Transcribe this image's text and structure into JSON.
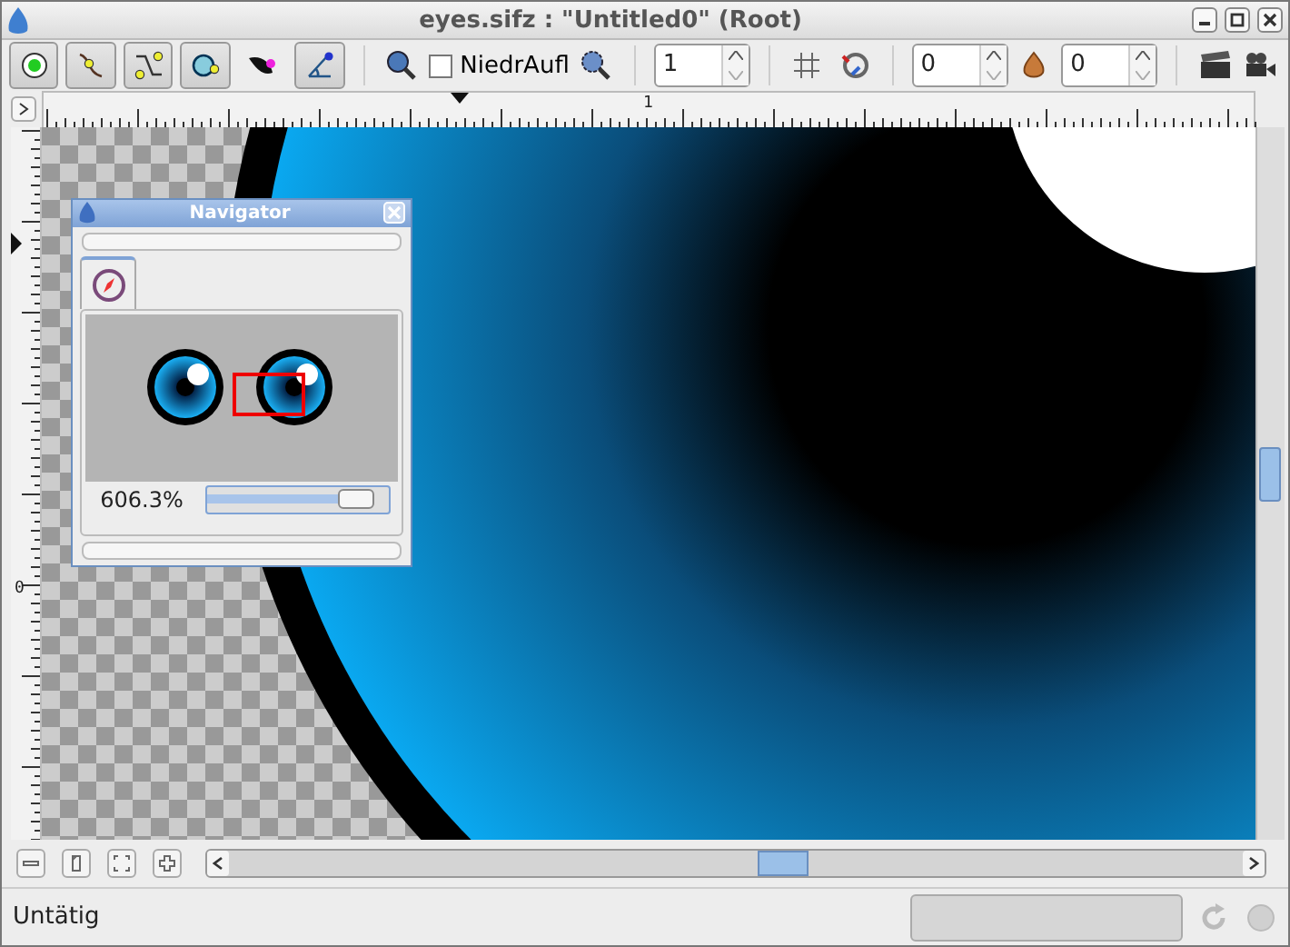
{
  "window": {
    "title": "eyes.sifz : \"Untitled0\" (Root)"
  },
  "toolbar": {
    "tools": [
      {
        "kind": "circle",
        "on": true
      },
      {
        "kind": "bline",
        "on": true
      },
      {
        "kind": "transform",
        "on": true
      },
      {
        "kind": "ring",
        "on": true
      },
      {
        "kind": "feather",
        "on": false
      },
      {
        "kind": "draw",
        "on": true
      }
    ],
    "low_res": {
      "label": "NiedrAufl",
      "checked": false
    },
    "quality": "1",
    "time_a": "0",
    "time_b": "0"
  },
  "rulers": {
    "top_label": "1",
    "left_label": "0"
  },
  "navigator": {
    "title": "Navigator",
    "zoom": "606.3%",
    "level": 0.82
  },
  "status_bar": {
    "text": "Untätig",
    "progress": {
      "level": 0
    }
  }
}
